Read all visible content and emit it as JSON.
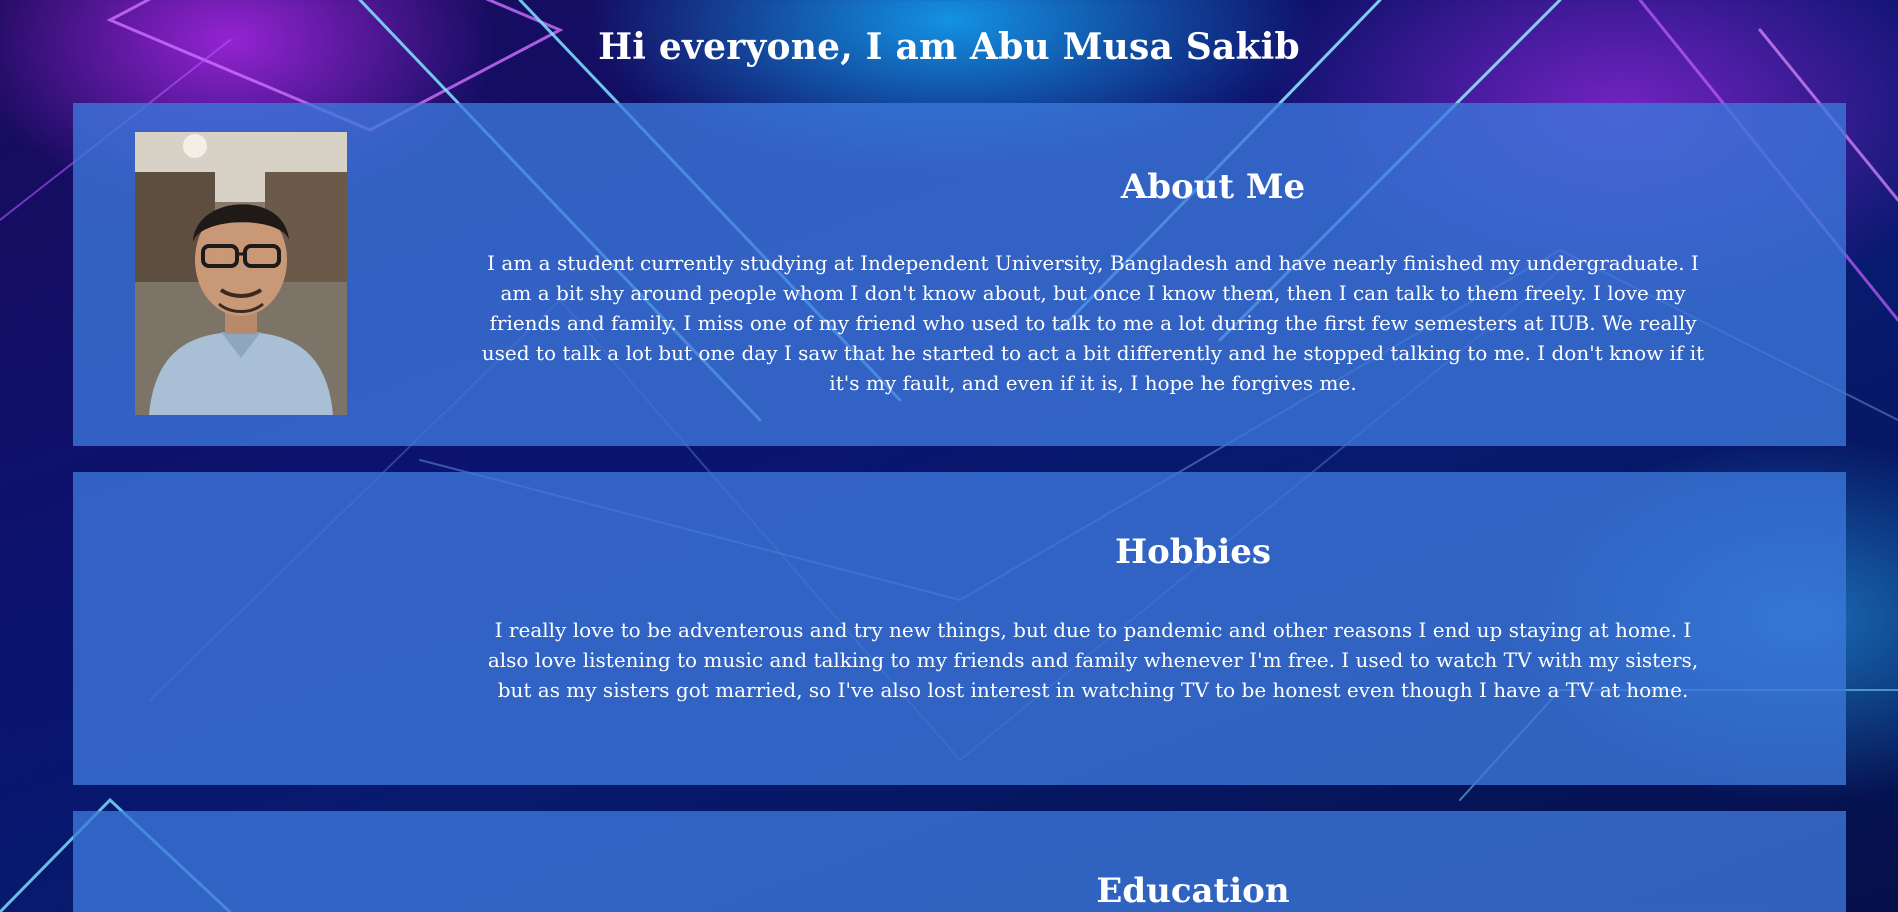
{
  "header": {
    "title": "Hi everyone, I am Abu Musa Sakib"
  },
  "about": {
    "heading": "About Me",
    "photo_icon": "profile-photo",
    "text": "I am a student currently studying at Independent University, Bangladesh and have nearly finished my undergraduate. I am a bit shy around people whom I don't know about, but once I know them, then I can talk to them freely. I love my friends and family. I miss one of my friend who used to talk to me a lot during the first few semesters at IUB. We really used to talk a lot but one day I saw that he started to act a bit differently and he stopped talking to me. I don't know if it it's my fault, and even if it is, I hope he forgives me."
  },
  "hobbies": {
    "heading": "Hobbies",
    "text": "I really love to be adventerous and try new things, but due to pandemic and other reasons I end up staying at home. I also love listening to music and talking to my friends and family whenever I'm free. I used to watch TV with my sisters, but as my sisters got married, so I've also lost interest in watching TV to be honest even though I have a TV at home."
  },
  "education": {
    "heading": "Education"
  },
  "colors": {
    "card": "#3c78dc",
    "background_dark": "#071a6e",
    "accent_purple": "#a02ee6",
    "accent_cyan": "#28b4ff",
    "text": "#ffffff"
  }
}
